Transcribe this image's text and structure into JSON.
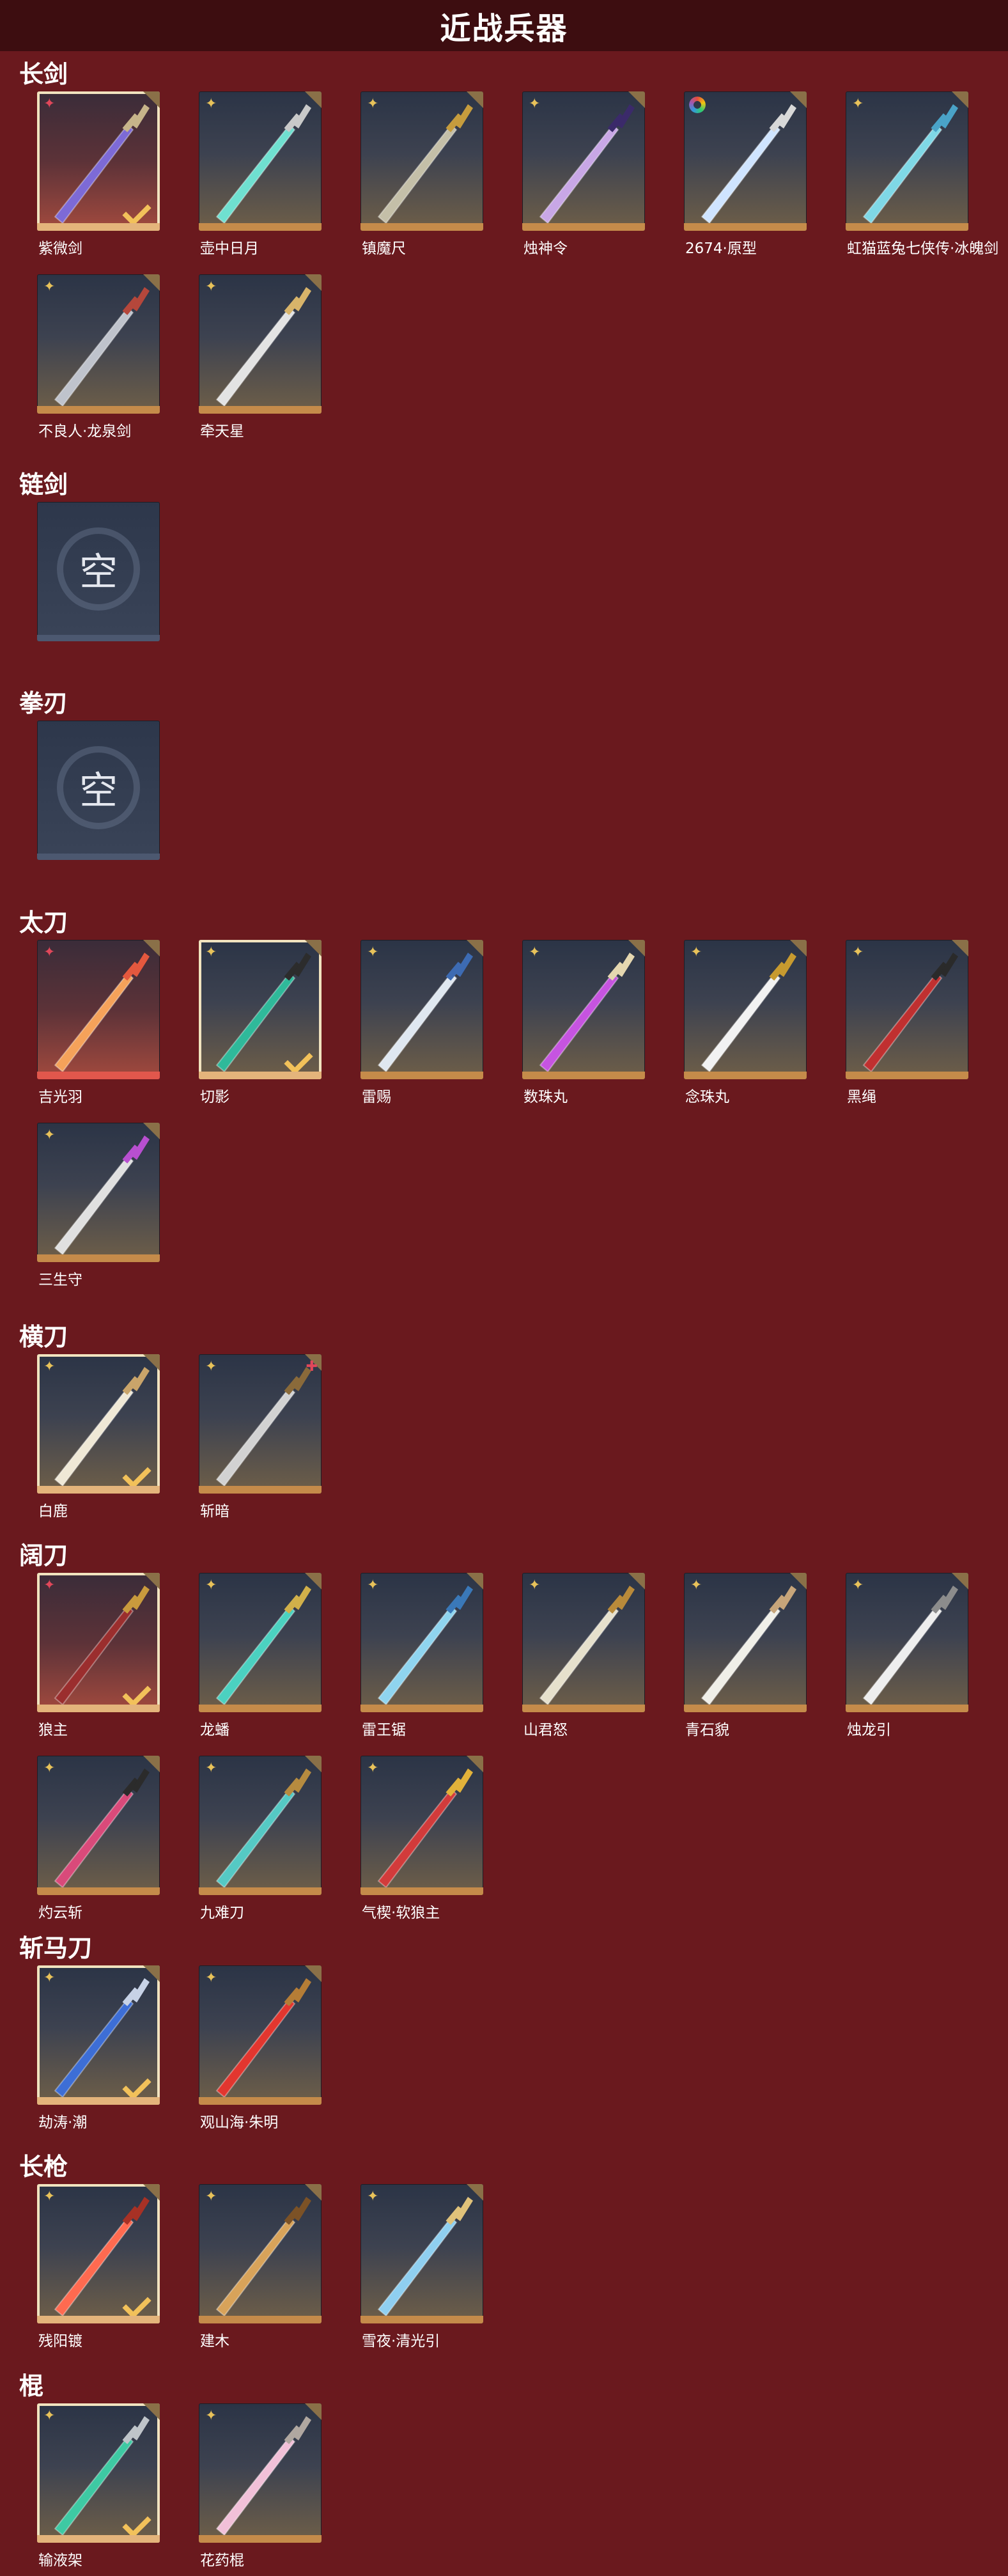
{
  "title": "近战兵器",
  "sections": [
    {
      "name": "长剑",
      "items": [
        {
          "name": "紫微剑",
          "rarity": "red",
          "selected": true,
          "blade": "#7d6ad6",
          "hilt": "#c7b48a",
          "icon": "sword-icon"
        },
        {
          "name": "壶中日月",
          "rarity": "gold",
          "selected": false,
          "blade": "#6fe0d0",
          "hilt": "#c9c9c9",
          "icon": "sword-icon"
        },
        {
          "name": "镇魔尺",
          "rarity": "gold",
          "selected": false,
          "blade": "#c4bfa8",
          "hilt": "#c69c3d",
          "icon": "sword-icon"
        },
        {
          "name": "烛神令",
          "rarity": "gold",
          "selected": false,
          "blade": "#c8a7e6",
          "hilt": "#3b2a6a",
          "icon": "sword-icon"
        },
        {
          "name": "2674·原型",
          "rarity": "rainbow",
          "selected": false,
          "blade": "#cfe4ff",
          "hilt": "#d8d8d8",
          "icon": "sword-icon"
        },
        {
          "name": "虹猫蓝兔七侠传·冰魄剑",
          "rarity": "gold",
          "selected": false,
          "blade": "#7fd8e6",
          "hilt": "#4aa3c8",
          "icon": "sword-icon"
        },
        {
          "name": "不良人·龙泉剑",
          "rarity": "gold",
          "selected": false,
          "blade": "#bfc3cc",
          "hilt": "#b5473b",
          "icon": "sword-icon"
        },
        {
          "name": "牵天星",
          "rarity": "gold",
          "selected": false,
          "blade": "#e3e3e3",
          "hilt": "#d8b46a",
          "icon": "sword-icon"
        }
      ]
    },
    {
      "name": "链剑",
      "items": [
        {
          "name": "",
          "empty": true,
          "glyph": "空"
        }
      ]
    },
    {
      "name": "拳刃",
      "items": [
        {
          "name": "",
          "empty": true,
          "glyph": "空"
        }
      ]
    },
    {
      "name": "太刀",
      "items": [
        {
          "name": "吉光羽",
          "rarity": "red",
          "selected": false,
          "blade": "#f5a25a",
          "hilt": "#e4583e",
          "icon": "katana-icon"
        },
        {
          "name": "切影",
          "rarity": "gold",
          "selected": true,
          "blade": "#2fb99a",
          "hilt": "#2c2c2c",
          "icon": "katana-icon"
        },
        {
          "name": "雷赐",
          "rarity": "gold",
          "selected": false,
          "blade": "#dfe7f0",
          "hilt": "#3d6bb3",
          "icon": "katana-icon"
        },
        {
          "name": "数珠丸",
          "rarity": "gold",
          "selected": false,
          "blade": "#c654e0",
          "hilt": "#e5d7b0",
          "icon": "katana-icon"
        },
        {
          "name": "念珠丸",
          "rarity": "gold",
          "selected": false,
          "blade": "#f2f2f2",
          "hilt": "#c79a2f",
          "icon": "katana-icon"
        },
        {
          "name": "黑绳",
          "rarity": "gold",
          "selected": false,
          "blade": "#c03030",
          "hilt": "#2a2a2a",
          "icon": "katana-icon"
        },
        {
          "name": "三生守",
          "rarity": "gold",
          "selected": false,
          "blade": "#e0e0e0",
          "hilt": "#b84fd0",
          "icon": "katana-icon"
        }
      ]
    },
    {
      "name": "横刀",
      "items": [
        {
          "name": "白鹿",
          "rarity": "gold",
          "selected": true,
          "blade": "#efe8d6",
          "hilt": "#c9a46a",
          "icon": "saber-icon"
        },
        {
          "name": "斩暗",
          "rarity": "gold-red",
          "selected": false,
          "blade": "#d2d2d2",
          "hilt": "#8a6a3a",
          "icon": "saber-icon"
        }
      ]
    },
    {
      "name": "阔刀",
      "items": [
        {
          "name": "狼主",
          "rarity": "red",
          "selected": true,
          "blade": "#9b2e2e",
          "hilt": "#c99a3d",
          "icon": "broadsword-icon"
        },
        {
          "name": "龙蟠",
          "rarity": "gold",
          "selected": false,
          "blade": "#4bd1c0",
          "hilt": "#d1b04a",
          "icon": "broadsword-icon"
        },
        {
          "name": "雷王锯",
          "rarity": "gold",
          "selected": false,
          "blade": "#8fd4ef",
          "hilt": "#3a78b8",
          "icon": "broadsword-icon"
        },
        {
          "name": "山君怒",
          "rarity": "gold",
          "selected": false,
          "blade": "#e6e0cc",
          "hilt": "#b98a3a",
          "icon": "broadsword-icon"
        },
        {
          "name": "青石貌",
          "rarity": "gold",
          "selected": false,
          "blade": "#f0efe8",
          "hilt": "#c7a57a",
          "icon": "broadsword-icon"
        },
        {
          "name": "烛龙引",
          "rarity": "gold",
          "selected": false,
          "blade": "#eeeeee",
          "hilt": "#8c8c8c",
          "icon": "broadsword-icon"
        },
        {
          "name": "灼云斩",
          "rarity": "gold",
          "selected": false,
          "blade": "#d94a7a",
          "hilt": "#2b2b2b",
          "icon": "broadsword-icon"
        },
        {
          "name": "九难刀",
          "rarity": "gold",
          "selected": false,
          "blade": "#55c9c4",
          "hilt": "#b68b3f",
          "icon": "broadsword-icon"
        },
        {
          "name": "气楔·软狼主",
          "rarity": "gold",
          "selected": false,
          "blade": "#d23b3b",
          "hilt": "#e2b23a",
          "icon": "broadsword-icon"
        }
      ]
    },
    {
      "name": "斩马刀",
      "items": [
        {
          "name": "劫涛·潮",
          "rarity": "gold",
          "selected": true,
          "blade": "#3d6ed6",
          "hilt": "#c7d2e6",
          "icon": "glaive-icon"
        },
        {
          "name": "观山海·朱明",
          "rarity": "gold",
          "selected": false,
          "blade": "#e2362f",
          "hilt": "#b57d36",
          "icon": "glaive-icon"
        }
      ]
    },
    {
      "name": "长枪",
      "items": [
        {
          "name": "残阳镀",
          "rarity": "gold",
          "selected": true,
          "blade": "#ff6a50",
          "hilt": "#a73125",
          "icon": "spear-icon"
        },
        {
          "name": "建木",
          "rarity": "gold",
          "selected": false,
          "blade": "#d8a35a",
          "hilt": "#7c5226",
          "icon": "spear-icon"
        },
        {
          "name": "雪夜·清光引",
          "rarity": "gold",
          "selected": false,
          "blade": "#8fcff0",
          "hilt": "#e0c27a",
          "icon": "spear-icon"
        }
      ]
    },
    {
      "name": "棍",
      "items": [
        {
          "name": "输液架",
          "rarity": "gold",
          "selected": true,
          "blade": "#3ec9a3",
          "hilt": "#bfc4c9",
          "icon": "staff-icon"
        },
        {
          "name": "花药棍",
          "rarity": "gold",
          "selected": false,
          "blade": "#f1c0d8",
          "hilt": "#b0a7a0",
          "icon": "staff-icon"
        }
      ]
    }
  ]
}
